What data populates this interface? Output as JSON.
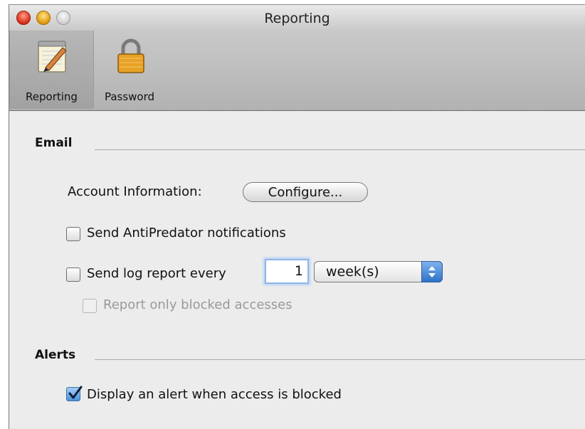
{
  "window": {
    "title": "Reporting"
  },
  "toolbar": {
    "items": [
      {
        "label": "Reporting",
        "icon": "notepad-pencil-icon",
        "selected": true
      },
      {
        "label": "Password",
        "icon": "lock-icon",
        "selected": false
      }
    ]
  },
  "email": {
    "section_title": "Email",
    "account_label": "Account Information:",
    "configure_button": "Configure...",
    "antipredator": {
      "label": "Send AntiPredator notifications",
      "checked": false
    },
    "log_report": {
      "label": "Send log report every",
      "checked": false,
      "count": "1",
      "unit": "week(s)"
    },
    "blocked_only": {
      "label": "Report only blocked accesses",
      "checked": false,
      "enabled": false
    }
  },
  "alerts": {
    "section_title": "Alerts",
    "display_alert": {
      "label": "Display an alert when access is blocked",
      "checked": true
    }
  }
}
